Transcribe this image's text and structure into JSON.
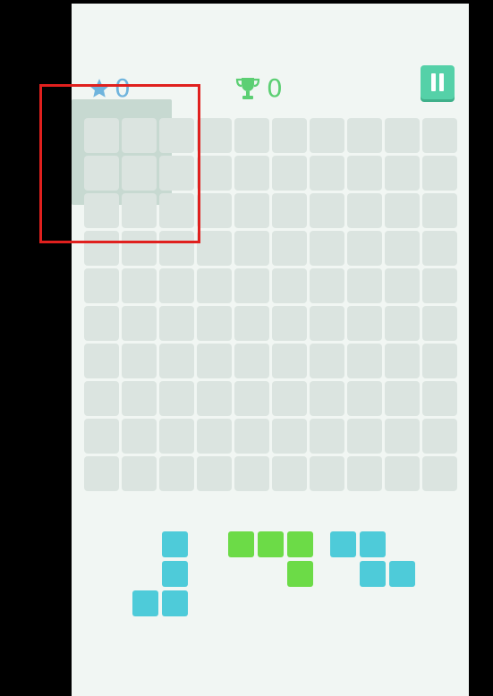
{
  "hud": {
    "score": "0",
    "best_score": "0",
    "star_icon": "star-icon",
    "trophy_icon": "trophy-icon",
    "pause_icon": "pause-icon"
  },
  "board": {
    "rows": 10,
    "cols": 10,
    "filled_cells": 0
  },
  "pieces": [
    {
      "name": "j-piece",
      "color": "#4ecbd9",
      "shape": [
        [
          0,
          1
        ],
        [
          0,
          1
        ],
        [
          1,
          1
        ]
      ]
    },
    {
      "name": "t-piece",
      "color": "#6cdb47",
      "shape": [
        [
          1,
          1,
          1
        ],
        [
          0,
          0,
          1
        ]
      ]
    },
    {
      "name": "z-piece",
      "color": "#4ecbd9",
      "shape": [
        [
          1,
          1,
          0
        ],
        [
          0,
          1,
          1
        ]
      ]
    }
  ],
  "colors": {
    "background": "#f1f6f3",
    "empty_cell": "#dbe4e0",
    "accent_pause": "#55d1a8",
    "score_blue": "#6fb4dd",
    "best_green": "#5ccf73",
    "highlight_red": "#e0201e"
  }
}
